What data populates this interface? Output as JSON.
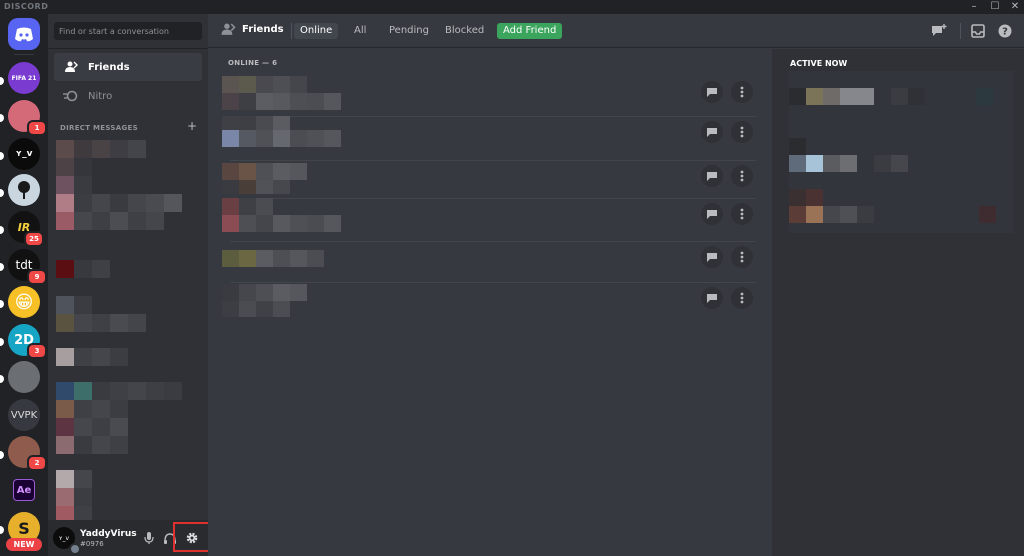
{
  "window": {
    "brand": "DISCORD"
  },
  "colors": {
    "accent": "#5865f2",
    "green": "#3ba55d",
    "red": "#f04747",
    "bg_main": "#36393f",
    "bg_sidebar": "#2f3136",
    "bg_rail": "#202225"
  },
  "servers": [
    {
      "name": "home-button",
      "icon": "discord-logo-icon",
      "label": ""
    },
    {
      "name": "server-fifa21",
      "label": "FIFA 21",
      "badge": ""
    },
    {
      "name": "server-red-avatar",
      "label": "",
      "badge": "1"
    },
    {
      "name": "server-yv",
      "label": "ʏ_ᴠ",
      "badge": ""
    },
    {
      "name": "server-tree",
      "label": "",
      "badge": ""
    },
    {
      "name": "server-ir",
      "label": "IR",
      "badge": "25"
    },
    {
      "name": "server-tdt",
      "label": "tdt",
      "badge": "9"
    },
    {
      "name": "server-emoji",
      "label": "😁",
      "badge": ""
    },
    {
      "name": "server-2d",
      "label": "2D",
      "badge": "3"
    },
    {
      "name": "server-car",
      "label": "",
      "badge": ""
    },
    {
      "name": "server-vvpk",
      "label": "VVPK",
      "badge": ""
    },
    {
      "name": "server-person",
      "label": "",
      "badge": "2"
    },
    {
      "name": "server-ae",
      "label": "Ae",
      "badge": ""
    },
    {
      "name": "server-s",
      "label": "S",
      "badge": ""
    }
  ],
  "new_badge": "NEW",
  "sidebar": {
    "search_placeholder": "Find or start a conversation",
    "nav": [
      {
        "label": "Friends",
        "icon": "friends-icon"
      },
      {
        "label": "Nitro",
        "icon": "nitro-icon"
      }
    ],
    "dm_header": "DIRECT MESSAGES",
    "dm_add": "+"
  },
  "user": {
    "username": "YaddyVirus",
    "tag": "#0976",
    "avatar_text": "ʏ_ᴠ"
  },
  "topbar": {
    "title": "Friends",
    "tabs": [
      "Online",
      "All",
      "Pending",
      "Blocked"
    ],
    "selected_tab": "Online",
    "add_friend": "Add Friend"
  },
  "friends": {
    "header": "ONLINE — 6",
    "count": 6
  },
  "active_now": {
    "header": "ACTIVE NOW"
  }
}
